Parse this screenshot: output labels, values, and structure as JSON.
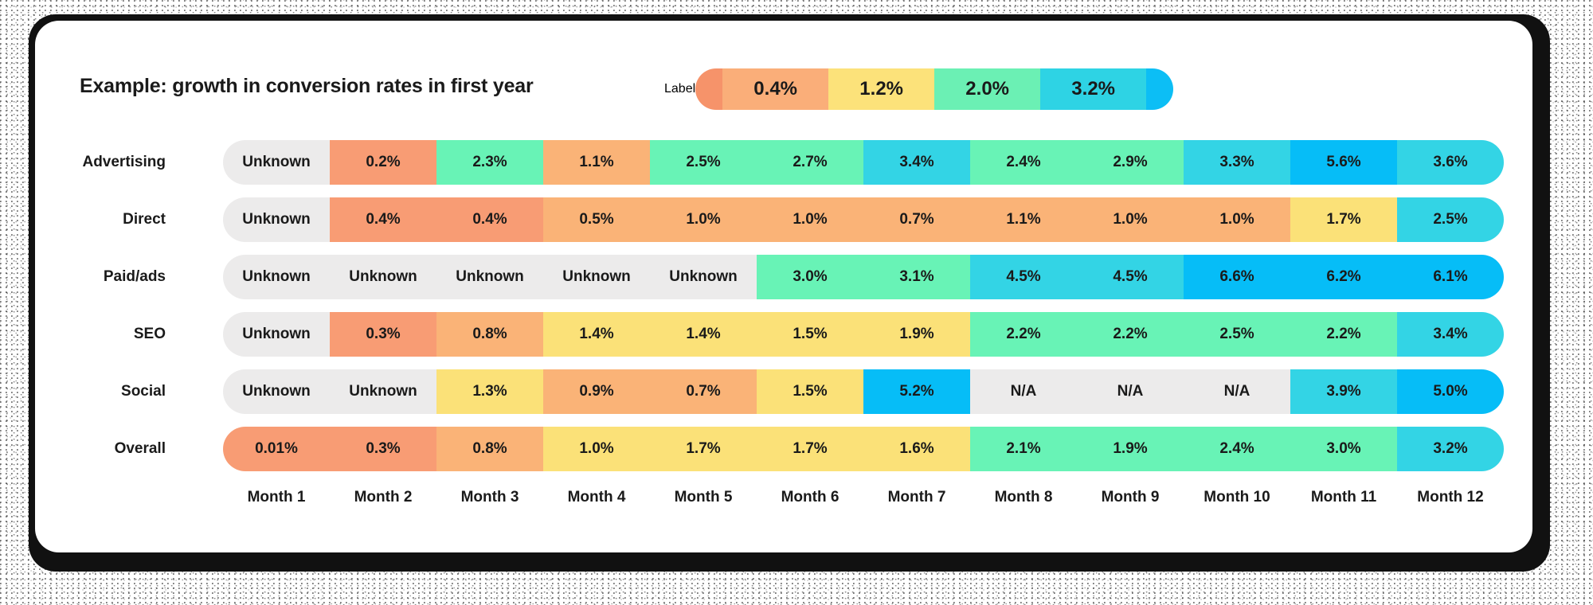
{
  "title": "Example: growth in conversion rates in first year",
  "legend": {
    "label": "Label",
    "stops": [
      "0.4%",
      "1.2%",
      "2.0%",
      "3.2%"
    ],
    "colors": {
      "cap_start": "#F6936A",
      "s1": "#FAAE79",
      "s2": "#FCE27A",
      "s3": "#6BF0B4",
      "s4": "#2ED3E4",
      "cap_end": "#0CBEF5"
    }
  },
  "palette": {
    "unknown": "#ECEBEB",
    "na": "#ECEBEB",
    "salmon": "#F89C74",
    "orange": "#FAB377",
    "yellow": "#FBE178",
    "mint": "#68F3B6",
    "cyan": "#33D4E5",
    "blue": "#06BDF7"
  },
  "axis": {
    "months": [
      "Month 1",
      "Month 2",
      "Month 3",
      "Month 4",
      "Month 5",
      "Month 6",
      "Month 7",
      "Month 8",
      "Month 9",
      "Month 10",
      "Month 11",
      "Month 12"
    ]
  },
  "chart_data": {
    "type": "heatmap",
    "title": "Example: growth in conversion rates in first year",
    "xlabel": "",
    "ylabel": "",
    "x": [
      "Month 1",
      "Month 2",
      "Month 3",
      "Month 4",
      "Month 5",
      "Month 6",
      "Month 7",
      "Month 8",
      "Month 9",
      "Month 10",
      "Month 11",
      "Month 12"
    ],
    "categories": [
      "Advertising",
      "Direct",
      "Paid/ads",
      "SEO",
      "Social",
      "Overall"
    ],
    "legend": {
      "position": "top-right",
      "stops": [
        "0.4%",
        "1.2%",
        "2.0%",
        "3.2%"
      ],
      "label": "Label"
    },
    "grid": false,
    "rows": [
      {
        "label": "Advertising",
        "cells": [
          {
            "text": "Unknown",
            "color": "#ECEBEB"
          },
          {
            "text": "0.2%",
            "color": "#F89C74"
          },
          {
            "text": "2.3%",
            "color": "#68F3B6"
          },
          {
            "text": "1.1%",
            "color": "#FAB377"
          },
          {
            "text": "2.5%",
            "color": "#68F3B6"
          },
          {
            "text": "2.7%",
            "color": "#68F3B6"
          },
          {
            "text": "3.4%",
            "color": "#33D4E5"
          },
          {
            "text": "2.4%",
            "color": "#68F3B6"
          },
          {
            "text": "2.9%",
            "color": "#68F3B6"
          },
          {
            "text": "3.3%",
            "color": "#33D4E5"
          },
          {
            "text": "5.6%",
            "color": "#06BDF7"
          },
          {
            "text": "3.6%",
            "color": "#33D4E5"
          }
        ]
      },
      {
        "label": "Direct",
        "cells": [
          {
            "text": "Unknown",
            "color": "#ECEBEB"
          },
          {
            "text": "0.4%",
            "color": "#F89C74"
          },
          {
            "text": "0.4%",
            "color": "#F89C74"
          },
          {
            "text": "0.5%",
            "color": "#FAB377"
          },
          {
            "text": "1.0%",
            "color": "#FAB377"
          },
          {
            "text": "1.0%",
            "color": "#FAB377"
          },
          {
            "text": "0.7%",
            "color": "#FAB377"
          },
          {
            "text": "1.1%",
            "color": "#FAB377"
          },
          {
            "text": "1.0%",
            "color": "#FAB377"
          },
          {
            "text": "1.0%",
            "color": "#FAB377"
          },
          {
            "text": "1.7%",
            "color": "#FBE178"
          },
          {
            "text": "2.5%",
            "color": "#33D4E5"
          }
        ]
      },
      {
        "label": "Paid/ads",
        "cells": [
          {
            "text": "Unknown",
            "color": "#ECEBEB"
          },
          {
            "text": "Unknown",
            "color": "#ECEBEB"
          },
          {
            "text": "Unknown",
            "color": "#ECEBEB"
          },
          {
            "text": "Unknown",
            "color": "#ECEBEB"
          },
          {
            "text": "Unknown",
            "color": "#ECEBEB"
          },
          {
            "text": "3.0%",
            "color": "#68F3B6"
          },
          {
            "text": "3.1%",
            "color": "#68F3B6"
          },
          {
            "text": "4.5%",
            "color": "#33D4E5"
          },
          {
            "text": "4.5%",
            "color": "#33D4E5"
          },
          {
            "text": "6.6%",
            "color": "#06BDF7"
          },
          {
            "text": "6.2%",
            "color": "#06BDF7"
          },
          {
            "text": "6.1%",
            "color": "#06BDF7"
          }
        ]
      },
      {
        "label": "SEO",
        "cells": [
          {
            "text": "Unknown",
            "color": "#ECEBEB"
          },
          {
            "text": "0.3%",
            "color": "#F89C74"
          },
          {
            "text": "0.8%",
            "color": "#FAB377"
          },
          {
            "text": "1.4%",
            "color": "#FBE178"
          },
          {
            "text": "1.4%",
            "color": "#FBE178"
          },
          {
            "text": "1.5%",
            "color": "#FBE178"
          },
          {
            "text": "1.9%",
            "color": "#FBE178"
          },
          {
            "text": "2.2%",
            "color": "#68F3B6"
          },
          {
            "text": "2.2%",
            "color": "#68F3B6"
          },
          {
            "text": "2.5%",
            "color": "#68F3B6"
          },
          {
            "text": "2.2%",
            "color": "#68F3B6"
          },
          {
            "text": "3.4%",
            "color": "#33D4E5"
          }
        ]
      },
      {
        "label": "Social",
        "cells": [
          {
            "text": "Unknown",
            "color": "#ECEBEB"
          },
          {
            "text": "Unknown",
            "color": "#ECEBEB"
          },
          {
            "text": "1.3%",
            "color": "#FBE178"
          },
          {
            "text": "0.9%",
            "color": "#FAB377"
          },
          {
            "text": "0.7%",
            "color": "#FAB377"
          },
          {
            "text": "1.5%",
            "color": "#FBE178"
          },
          {
            "text": "5.2%",
            "color": "#06BDF7"
          },
          {
            "text": "N/A",
            "color": "#ECEBEB"
          },
          {
            "text": "N/A",
            "color": "#ECEBEB"
          },
          {
            "text": "N/A",
            "color": "#ECEBEB"
          },
          {
            "text": "3.9%",
            "color": "#33D4E5"
          },
          {
            "text": "5.0%",
            "color": "#06BDF7"
          }
        ]
      },
      {
        "label": "Overall",
        "cells": [
          {
            "text": "0.01%",
            "color": "#F89C74"
          },
          {
            "text": "0.3%",
            "color": "#F89C74"
          },
          {
            "text": "0.8%",
            "color": "#FAB377"
          },
          {
            "text": "1.0%",
            "color": "#FBE178"
          },
          {
            "text": "1.7%",
            "color": "#FBE178"
          },
          {
            "text": "1.7%",
            "color": "#FBE178"
          },
          {
            "text": "1.6%",
            "color": "#FBE178"
          },
          {
            "text": "2.1%",
            "color": "#68F3B6"
          },
          {
            "text": "1.9%",
            "color": "#68F3B6"
          },
          {
            "text": "2.4%",
            "color": "#68F3B6"
          },
          {
            "text": "3.0%",
            "color": "#68F3B6"
          },
          {
            "text": "3.2%",
            "color": "#33D4E5"
          }
        ]
      }
    ]
  }
}
